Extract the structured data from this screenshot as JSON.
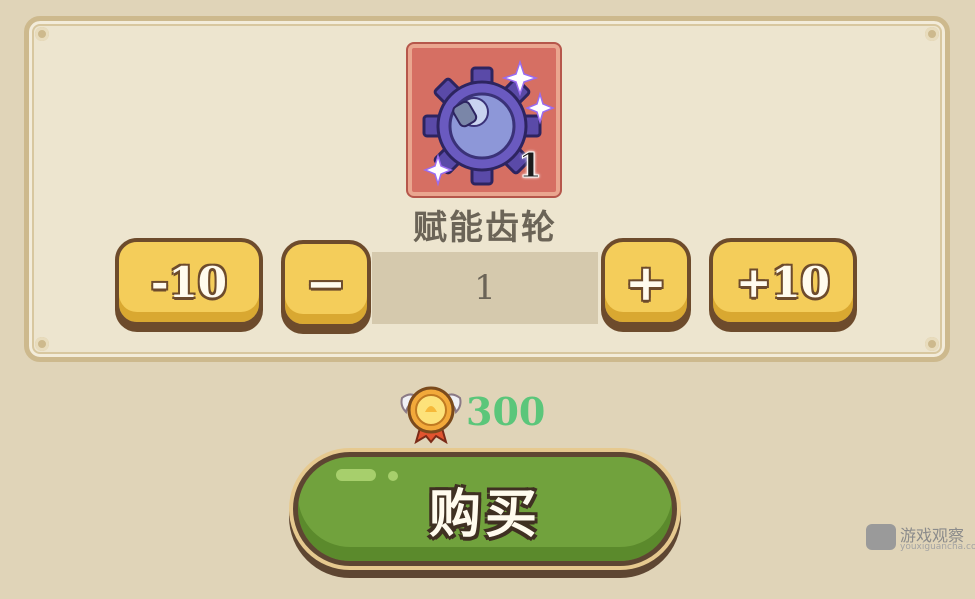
{
  "item": {
    "name": "赋能齿轮",
    "count": "1",
    "icon": "purple-gear-icon"
  },
  "quantity": {
    "value": "1",
    "minus10_label": "-10",
    "minus_label": "−",
    "plus_label": "+",
    "plus10_label": "+10"
  },
  "price": {
    "amount": "300",
    "currency_icon": "medal-coin-icon",
    "color": "#5bc67a"
  },
  "buy": {
    "label": "购买"
  },
  "watermark": {
    "text": "游戏观察",
    "sub": "youxiguancha.com"
  },
  "colors": {
    "background": "#e0d4b8",
    "panel": "#ede5cf",
    "button_yellow": "#f4cd5a",
    "button_green": "#71a23d",
    "item_card": "#d66f63"
  }
}
